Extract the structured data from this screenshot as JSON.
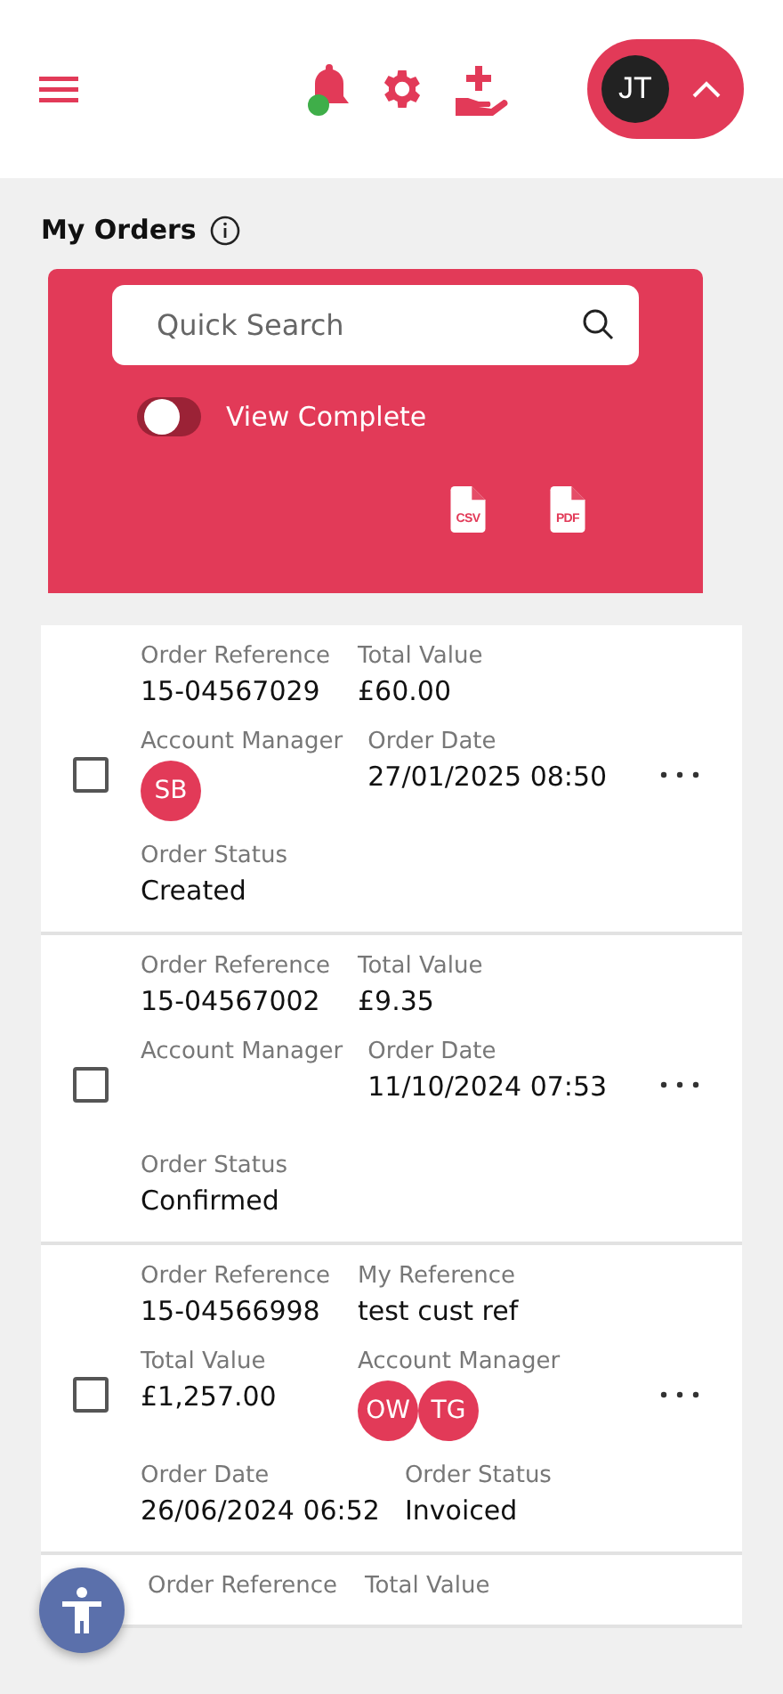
{
  "header": {
    "user_initials": "JT",
    "notification_dot": true
  },
  "page": {
    "title": "My Orders"
  },
  "filters": {
    "search_placeholder": "Quick Search",
    "exports": [
      "CSV",
      "PDF"
    ],
    "toggle": {
      "label": "View Complete",
      "on": false
    }
  },
  "orders": [
    {
      "checked": false,
      "rows": [
        [
          {
            "label": "Order Reference",
            "value": "15-04567029"
          },
          {
            "label": "Total Value",
            "value": "£60.00"
          }
        ],
        [
          {
            "label": "Account Manager",
            "avatars": [
              "SB"
            ]
          },
          {
            "label": "Order Date",
            "value": "27/01/2025 08:50"
          }
        ],
        [
          {
            "label": "Order Status",
            "value": "Created"
          }
        ]
      ]
    },
    {
      "checked": false,
      "rows": [
        [
          {
            "label": "Order Reference",
            "value": "15-04567002"
          },
          {
            "label": "Total Value",
            "value": "£9.35"
          }
        ],
        [
          {
            "label": "Account Manager"
          },
          {
            "label": "Order Date",
            "value": "11/10/2024 07:53"
          }
        ],
        [
          {
            "label": "Order Status",
            "value": "Confirmed"
          }
        ]
      ]
    },
    {
      "checked": false,
      "rows": [
        [
          {
            "label": "Order Reference",
            "value": "15-04566998"
          },
          {
            "label": "My Reference",
            "value": "test cust ref"
          }
        ],
        [
          {
            "label": "Total Value",
            "value": "£1,257.00"
          },
          {
            "label": "Account Manager",
            "avatars": [
              "OW",
              "TG"
            ]
          }
        ],
        [
          {
            "label": "Order Date",
            "value": "26/06/2024 06:52"
          },
          {
            "label": "Order Status",
            "value": "Invoiced"
          }
        ]
      ]
    },
    {
      "rows": [
        [
          {
            "label": "Order Reference"
          },
          {
            "label": "Total Value"
          }
        ]
      ]
    }
  ]
}
